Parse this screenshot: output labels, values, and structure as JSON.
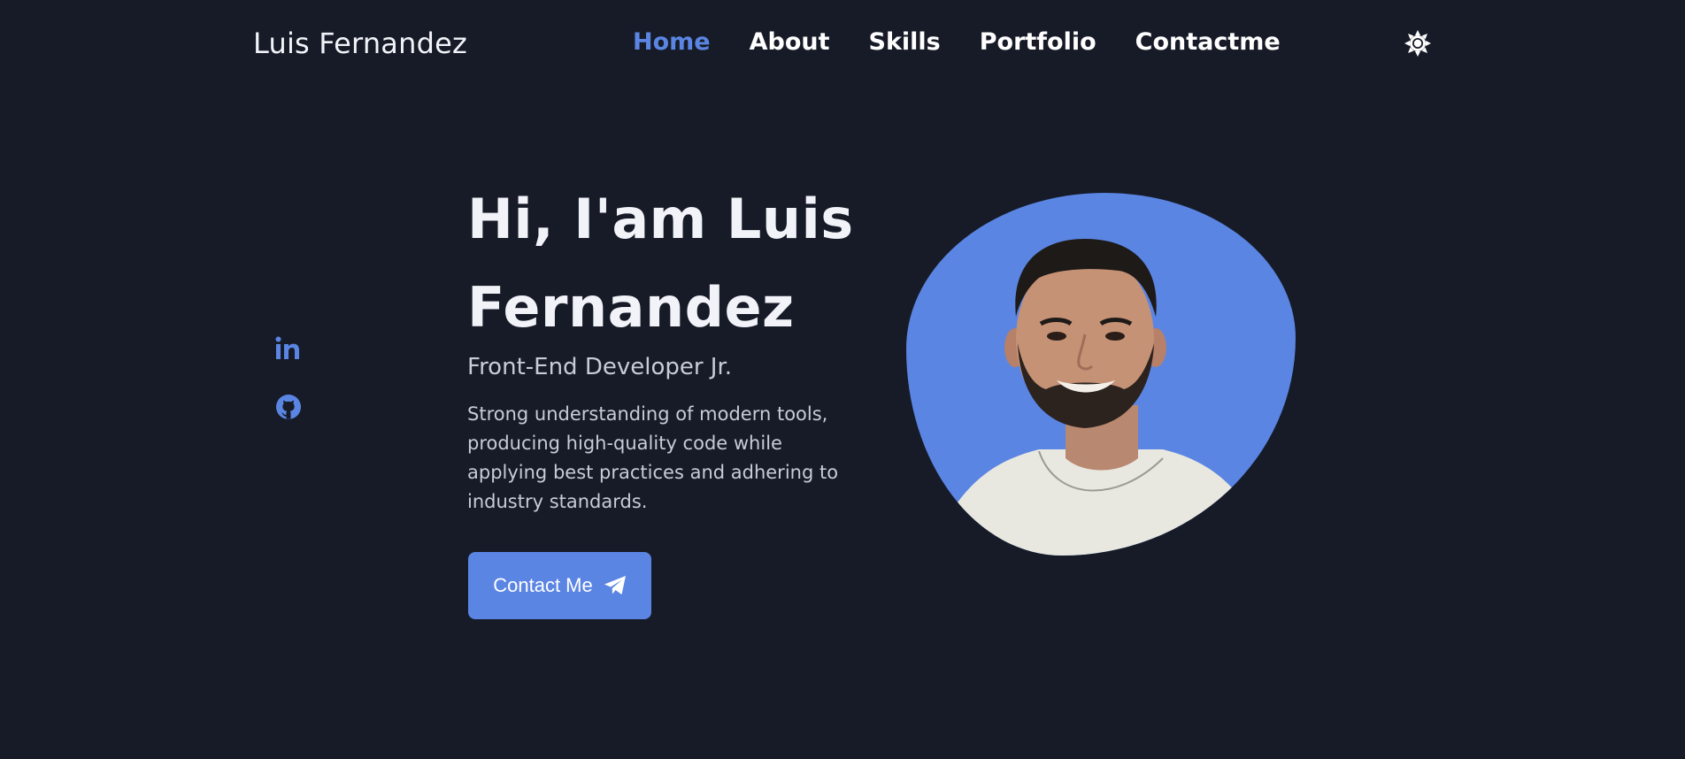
{
  "header": {
    "logo": "Luis Fernandez",
    "nav": [
      {
        "label": "Home",
        "active": true
      },
      {
        "label": "About"
      },
      {
        "label": "Skills"
      },
      {
        "label": "Portfolio"
      },
      {
        "label": "Contactme"
      }
    ],
    "theme_icon": "sun-icon"
  },
  "social": [
    {
      "icon": "linkedin-icon"
    },
    {
      "icon": "github-icon"
    }
  ],
  "hero": {
    "title_line1": "Hi, I'am Luis",
    "title_line2": "Fernandez",
    "subtitle": "Front-End Developer Jr.",
    "description": "Strong understanding of modern tools, producing high-quality code while applying best practices and adhering to industry standards.",
    "button_label": "Contact Me",
    "button_icon": "paper-plane-icon"
  },
  "colors": {
    "background": "#161b27",
    "accent": "#5b85e3",
    "text": "#ffffff",
    "muted_text": "#c7ccd8"
  }
}
